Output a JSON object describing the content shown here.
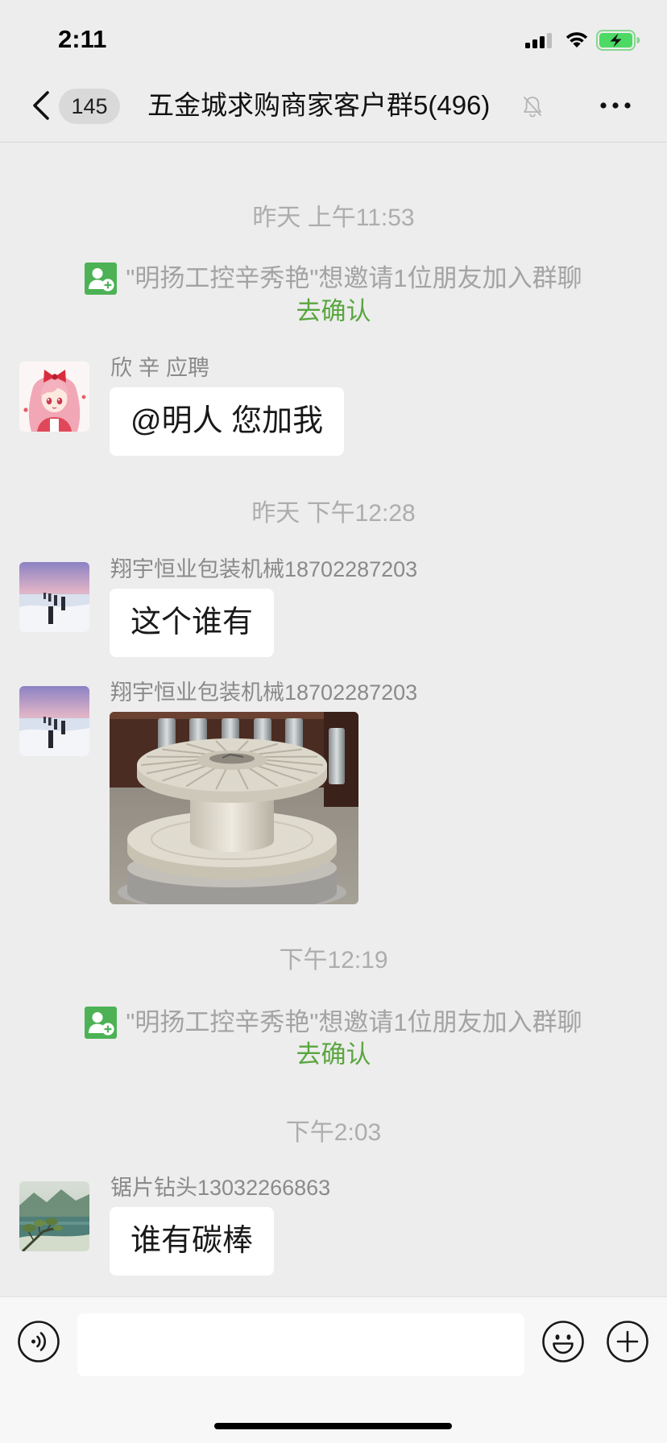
{
  "status_bar": {
    "time": "2:11",
    "icons": {
      "signal": "cellular-signal-icon",
      "wifi": "wifi-icon",
      "battery": "battery-charging-icon"
    }
  },
  "header": {
    "back_icon": "chevron-left-icon",
    "unread_count": "145",
    "title": "五金城求购商家客户群5(496)",
    "mute_icon": "bell-off-icon",
    "more_icon": "more-dots-icon"
  },
  "chat": [
    {
      "timestamp": "昨天 上午11:53"
    },
    {
      "system_notice": {
        "icon": "add-member-icon",
        "text": "\"明扬工控辛秀艳\"想邀请1位朋友加入群聊",
        "action": "去确认"
      }
    },
    {
      "message": {
        "sender": "欣 辛 应聘",
        "text": "@明人 您加我"
      }
    },
    {
      "timestamp": "昨天 下午12:28"
    },
    {
      "message": {
        "sender": "翔宇恒业包装机械18702287203",
        "text": "这个谁有"
      }
    },
    {
      "message": {
        "sender": "翔宇恒业包装机械18702287203",
        "image": true
      }
    },
    {
      "timestamp": "下午12:19"
    },
    {
      "system_notice": {
        "icon": "add-member-icon",
        "text": "\"明扬工控辛秀艳\"想邀请1位朋友加入群聊",
        "action": "去确认"
      }
    },
    {
      "timestamp": "下午2:03"
    },
    {
      "message": {
        "sender": "锯片钻头13032266863",
        "text": "谁有碳棒"
      }
    }
  ],
  "composer": {
    "voice_icon": "voice-input-icon",
    "input_value": "",
    "emoji_icon": "emoji-icon",
    "plus_icon": "plus-circle-icon"
  },
  "colors": {
    "background": "#ededed",
    "bubble": "#ffffff",
    "link_green": "#5aa640",
    "invite_icon_green": "#4cb255",
    "timestamp_gray": "#adadad",
    "system_text_gray": "#a3a3a3",
    "sender_gray": "#8a8a8a",
    "composer_bg": "#f7f7f7"
  }
}
